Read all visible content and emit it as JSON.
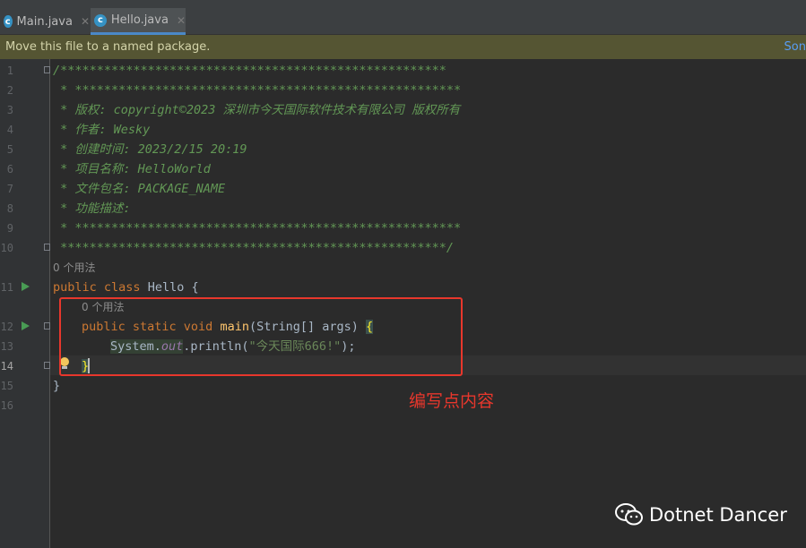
{
  "tabs": [
    {
      "label": "Main.java",
      "icon": "java-class-icon",
      "active": false
    },
    {
      "label": "Hello.java",
      "icon": "java-class-icon",
      "active": true
    }
  ],
  "banner": {
    "message": "Move this file to a named package.",
    "link": "Son"
  },
  "editor": {
    "line_numbers": [
      "1",
      "2",
      "3",
      "4",
      "5",
      "6",
      "7",
      "8",
      "9",
      "10",
      "11",
      "12",
      "13",
      "14",
      "15",
      "16"
    ],
    "current_line": "14",
    "header_comment": [
      "/*****************************************************",
      " * *****************************************************",
      " * 版权: copyright©2023 深圳市今天国际软件技术有限公司 版权所有",
      " * 作者: Wesky",
      " * 创建时间: 2023/2/15 20:19",
      " * 项目名称: HelloWorld",
      " * 文件包名: PACKAGE_NAME",
      " * 功能描述:",
      " * *****************************************************",
      " *****************************************************/"
    ],
    "usage_hint_class": "0 个用法",
    "usage_hint_method": "0 个用法",
    "code": {
      "class_kw": "public class",
      "class_name": "Hello",
      "open_brace": "{",
      "method_kw": "public static void",
      "method_name": "main",
      "method_params": "(String[] args)",
      "method_brace": "{",
      "stmt_obj": "System.",
      "stmt_field": "out",
      "stmt_call": ".println(",
      "stmt_string": "\"今天国际666!\"",
      "stmt_end": ");",
      "method_close": "}",
      "class_close": "}"
    }
  },
  "annotation": {
    "label": "编写点内容",
    "color": "#e8372c"
  },
  "watermark": {
    "text": "Dotnet Dancer",
    "icon": "wechat-icon"
  },
  "colors": {
    "background": "#2b2b2b",
    "comment": "#629755",
    "keyword": "#cc7832",
    "function": "#ffc66d",
    "string": "#6a8759",
    "run_icon": "#499c54"
  }
}
